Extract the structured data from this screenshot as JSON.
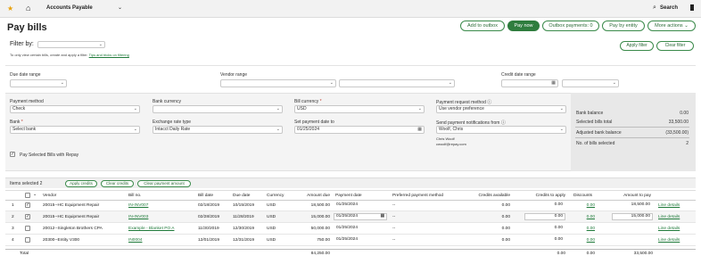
{
  "topbar": {
    "app": "Accounts Payable",
    "search": "Search"
  },
  "page": {
    "title": "Pay bills"
  },
  "actions": {
    "add_outbox": "Add to outbox",
    "pay_now": "Pay now",
    "outbox_payments": "Outbox payments: 0",
    "pay_by_entity": "Pay by entity",
    "more_actions": "More actions"
  },
  "filter": {
    "label": "Filter by:",
    "hint": "To only view certain bills, create and apply a filter.",
    "hint_link": "Tips and tricks on filtering",
    "apply": "Apply filter",
    "clear": "Clear filter"
  },
  "ranges": {
    "due_date": "Due date range",
    "vendor": "Vendor range",
    "credit_date": "Credit date range"
  },
  "form": {
    "payment_method": {
      "label": "Payment method",
      "value": "Check"
    },
    "bank_currency": {
      "label": "Bank currency",
      "value": ""
    },
    "bill_currency": {
      "label": "Bill currency",
      "value": "USD"
    },
    "payment_request_method": {
      "label": "Payment request method",
      "value": "Use vendor preference"
    },
    "bank": {
      "label": "Bank",
      "value": "Select bank"
    },
    "exchange_rate_type": {
      "label": "Exchange rate type",
      "value": "Intacct Daily Rate"
    },
    "set_payment_date": {
      "label": "Set payment date to",
      "value": "01/25/2024"
    },
    "send_notifications": {
      "label": "Send payment notifications from",
      "value": "Woolf, Chris"
    },
    "contact_name": "Chris Woolf",
    "contact_email": "cwoolf@repay.com",
    "pay_selected_label": "Pay Selected Bills with Repay"
  },
  "summary": {
    "bank_balance": {
      "label": "Bank balance",
      "value": "0.00"
    },
    "selected_total": {
      "label": "Selected bills total",
      "value": "33,500.00"
    },
    "adjusted_balance": {
      "label": "Adjusted bank balance",
      "value": "(33,500.00)"
    },
    "num_selected": {
      "label": "No. of bills selected",
      "value": "2"
    }
  },
  "table": {
    "items_selected": "Items selected 2",
    "apply_credits": "Apply credits",
    "clear_credits": "Clear credits",
    "clear_payment_amount": "Clear payment amount",
    "headers": [
      "Vendor",
      "Bill no.",
      "Bill date",
      "Due date",
      "Currency",
      "Amount due",
      "Payment date",
      "Preferred payment method",
      "Credits available",
      "Credits to apply",
      "Discounts",
      "Amount to pay"
    ],
    "rows": [
      {
        "num": "1",
        "checked": true,
        "vendor": "20015--HC Equipment Repair",
        "bill": "IN-INV007",
        "bill_date": "02/18/2019",
        "due_date": "10/15/2019",
        "currency": "USD",
        "amount_due": "18,500.00",
        "payment_date": "01/25/2024",
        "pref": "--",
        "credits_avail": "0.00",
        "credits_apply": "0.00",
        "discounts": "0.00",
        "amount_pay": "18,500.00",
        "line": "Line details"
      },
      {
        "num": "2",
        "checked": true,
        "vendor": "20015--HC Equipment Repair",
        "bill": "IN-INV003",
        "bill_date": "02/28/2019",
        "due_date": "11/28/2019",
        "currency": "USD",
        "amount_due": "15,000.00",
        "payment_date": "01/25/2024",
        "pref": "--",
        "credits_avail": "0.00",
        "credits_apply": "0.00",
        "discounts": "0.00",
        "amount_pay": "15,000.00",
        "line": "Line details"
      },
      {
        "num": "3",
        "checked": false,
        "vendor": "20012--Singleton Brothers CPA",
        "bill": "Example - Blanket PO A",
        "bill_date": "11/30/2019",
        "due_date": "12/30/2019",
        "currency": "USD",
        "amount_due": "50,000.00",
        "payment_date": "01/25/2024",
        "pref": "--",
        "credits_avail": "0.00",
        "credits_apply": "0.00",
        "discounts": "0.00",
        "amount_pay": "",
        "line": "Line details"
      },
      {
        "num": "4",
        "checked": false,
        "vendor": "20300--Entity V300",
        "bill": "IN0004",
        "bill_date": "12/01/2019",
        "due_date": "12/31/2019",
        "currency": "USD",
        "amount_due": "750.00",
        "payment_date": "01/25/2024",
        "pref": "--",
        "credits_avail": "0.00",
        "credits_apply": "0.00",
        "discounts": "0.00",
        "amount_pay": "",
        "line": "Line details"
      }
    ],
    "total": {
      "label": "Total",
      "amount_due": "84,250.00",
      "credits_apply": "0.00",
      "discounts": "0.00",
      "amount_pay": "33,500.00"
    }
  }
}
